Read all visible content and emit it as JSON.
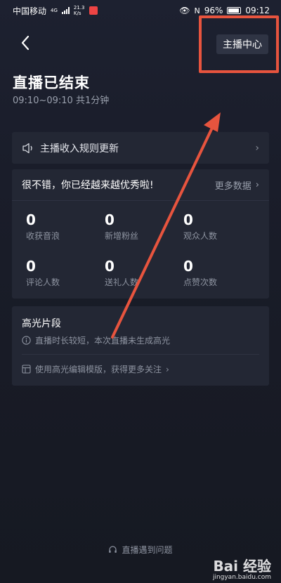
{
  "status_bar": {
    "carrier": "中国移动",
    "network": "4G",
    "speed_value": "21.3",
    "speed_unit": "K/s",
    "battery": "96%",
    "time": "09:12"
  },
  "header": {
    "center_button": "主播中心"
  },
  "summary": {
    "title": "直播已结束",
    "subtitle": "09:10~09:10 共1分钟"
  },
  "notice": {
    "label": "主播收入规则更新"
  },
  "stats": {
    "headline": "很不错，你已经越来越优秀啦!",
    "more_label": "更多数据",
    "items": [
      {
        "value": "0",
        "label": "收获音浪"
      },
      {
        "value": "0",
        "label": "新增粉丝"
      },
      {
        "value": "0",
        "label": "观众人数"
      },
      {
        "value": "0",
        "label": "评论人数"
      },
      {
        "value": "0",
        "label": "送礼人数"
      },
      {
        "value": "0",
        "label": "点赞次数"
      }
    ]
  },
  "highlights": {
    "title": "高光片段",
    "info": "直播时长较短，本次直播未生成高光",
    "template_link": "使用高光编辑模版，获得更多关注"
  },
  "footer": {
    "help": "直播遇到问题"
  },
  "watermark": {
    "logo": "Bai 经验",
    "sub": "jingyan.baidu.com"
  },
  "colors": {
    "background": "#171a23",
    "card": "#232734",
    "annotation": "#e7543e"
  }
}
